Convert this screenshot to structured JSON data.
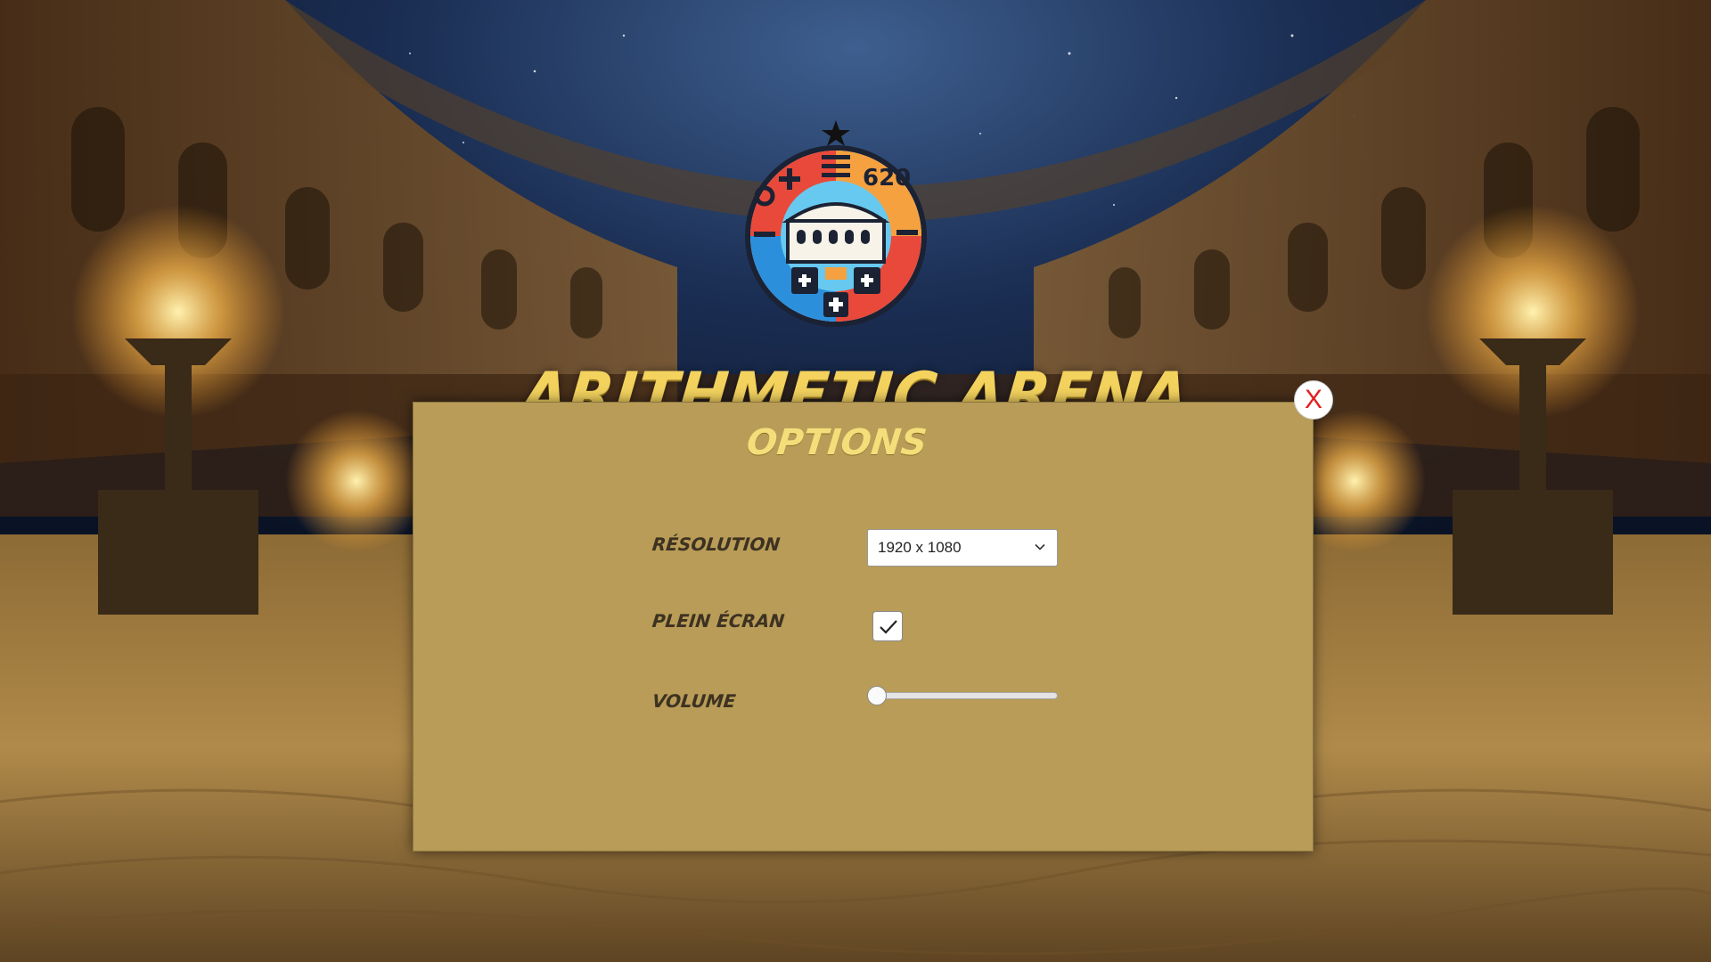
{
  "game": {
    "title": "ARITHMETIC ARENA",
    "logo_icon": "arena-math-emblem",
    "logo_numbers": "620"
  },
  "options_dialog": {
    "title": "OPTIONS",
    "close_label": "X",
    "close_icon": "close-icon",
    "resolution": {
      "label": "Résolution",
      "selected": "1920 x 1080",
      "icon": "chevron-down-icon"
    },
    "fullscreen": {
      "label": "Plein écran",
      "checked": true,
      "icon": "checkmark-icon"
    },
    "volume": {
      "label": "Volume",
      "value": 0.0
    }
  },
  "colors": {
    "panel": "#b89c57",
    "title_gold": "#f3d25e",
    "close_red": "#e02020"
  }
}
